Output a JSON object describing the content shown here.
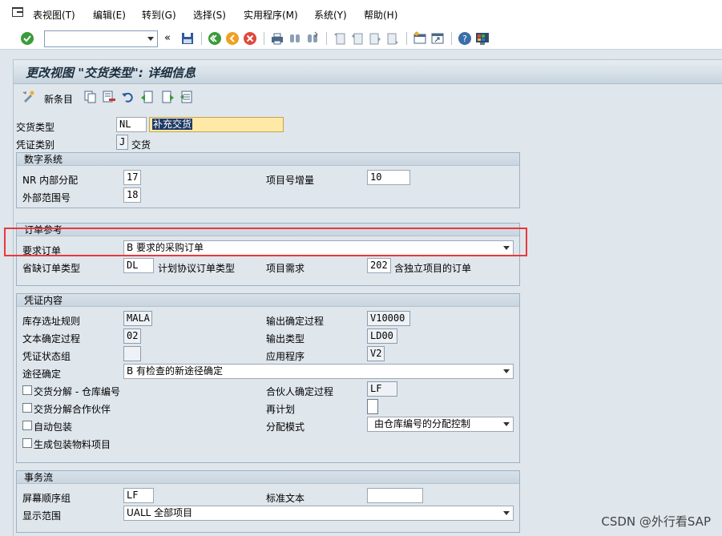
{
  "menu": {
    "items": [
      "表视图(T)",
      "编辑(E)",
      "转到(G)",
      "选择(S)",
      "实用程序(M)",
      "系统(Y)",
      "帮助(H)"
    ]
  },
  "toolbar": {
    "command_field_value": "",
    "icons": [
      "enter-icon",
      "back-icon",
      "save-icon",
      "exit-icon",
      "cancel-icon",
      "print-icon",
      "find-icon",
      "find-next-icon",
      "first-page-icon",
      "previous-page-icon",
      "next-page-icon",
      "last-page-icon",
      "new-session-icon",
      "shortcut-icon",
      "help-icon",
      "customize-layout-icon"
    ]
  },
  "page": {
    "title": "更改视图 \"交货类型\": 详细信息"
  },
  "app_toolbar": {
    "new_entries_label": "新条目",
    "icons": [
      "display-change-icon",
      "copy-icon",
      "delete-icon",
      "undo-icon",
      "previous-entry-icon",
      "next-entry-icon",
      "select-all-icon"
    ]
  },
  "header": {
    "delivery_type_label": "交货类型",
    "delivery_type_value": "NL",
    "delivery_type_desc": "补充交货",
    "doc_category_label": "凭证类别",
    "doc_category_value": "J",
    "doc_category_text": "交货"
  },
  "number_system": {
    "title": "数字系统",
    "nr_internal_label": "NR 内部分配",
    "nr_internal_value": "17",
    "item_increment_label": "项目号增量",
    "item_increment_value": "10",
    "external_range_label": "外部范围号",
    "external_range_value": "18"
  },
  "order_reference": {
    "title": "订单参考",
    "order_required_label": "要求订单",
    "order_required_value": "B 要求的采购订单",
    "default_order_type_label": "省缺订单类型",
    "default_order_type_value": "DL",
    "default_order_type_text": "计划协议订单类型",
    "item_requirement_label": "项目需求",
    "item_requirement_value": "202",
    "item_requirement_text": "含独立项目的订单"
  },
  "document_content": {
    "title": "凭证内容",
    "storage_loc_rule_label": "库存选址规则",
    "storage_loc_rule_value": "MALA",
    "output_det_proc_label": "输出确定过程",
    "output_det_proc_value": "V10000",
    "text_det_proc_label": "文本确定过程",
    "text_det_proc_value": "02",
    "output_type_label": "输出类型",
    "output_type_value": "LD00",
    "doc_status_group_label": "凭证状态组",
    "doc_status_group_value": "",
    "application_label": "应用程序",
    "application_value": "V2",
    "route_det_label": "途径确定",
    "route_det_value": "B 有检查的新途径确定",
    "split_wh_label": "交货分解 - 仓库编号",
    "partner_det_proc_label": "合伙人确定过程",
    "partner_det_proc_value": "LF",
    "split_partner_label": "交货分解合作伙伴",
    "rescheduling_label": "再计划",
    "auto_pack_label": "自动包装",
    "distrib_mode_label": "分配模式",
    "distrib_mode_value": "由仓库编号的分配控制",
    "gen_packing_label": "生成包装物料项目"
  },
  "transaction_flow": {
    "title": "事务流",
    "screen_seq_label": "屏幕顺序组",
    "screen_seq_value": "LF",
    "standard_text_label": "标准文本",
    "standard_text_value": "",
    "display_range_label": "显示范围",
    "display_range_value": "UALL 全部项目"
  },
  "watermark": "CSDN @外行看SAP",
  "colors": {
    "highlight": "#e8393d",
    "input_focus_bg": "#ffe9a6",
    "selection_bg": "#1d3a66"
  }
}
